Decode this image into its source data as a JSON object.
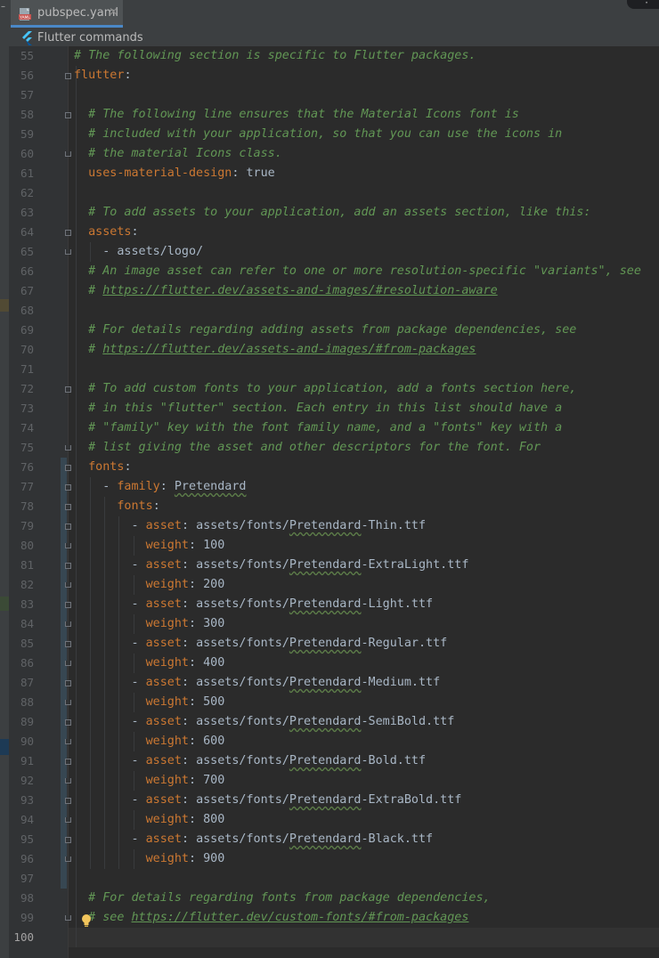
{
  "tab": {
    "title": "pubspec.yaml",
    "file_icon": "yaml-file-icon",
    "close_glyph": "×",
    "icon_badge": "YAML"
  },
  "toolbar": {
    "label": "Flutter commands",
    "icon": "flutter-icon"
  },
  "colors": {
    "comment": "#629755",
    "key": "#cc7832",
    "text": "#a9b7c6",
    "background": "#2b2b2b",
    "gutter": "#313335"
  },
  "current_line": 100,
  "lines": [
    {
      "n": "55",
      "indent": "",
      "comment": "# The following section is specific to Flutter packages."
    },
    {
      "n": "56",
      "indent": "",
      "key": "flutter",
      "sep": ":"
    },
    {
      "n": "57"
    },
    {
      "n": "58",
      "indent": "  ",
      "comment": "# The following line ensures that the Material Icons font is"
    },
    {
      "n": "59",
      "indent": "  ",
      "comment": "# included with your application, so that you can use the icons in"
    },
    {
      "n": "60",
      "indent": "  ",
      "comment": "# the material Icons class."
    },
    {
      "n": "61",
      "indent": "  ",
      "key": "uses-material-design",
      "sep": ": ",
      "value": "true"
    },
    {
      "n": "62"
    },
    {
      "n": "63",
      "indent": "  ",
      "comment": "# To add assets to your application, add an assets section, like this:"
    },
    {
      "n": "64",
      "indent": "  ",
      "key": "assets",
      "sep": ":"
    },
    {
      "n": "65",
      "indent": "    ",
      "plain": "- assets/logo/"
    },
    {
      "n": "66",
      "indent": "  ",
      "comment": "# An image asset can refer to one or more resolution-specific \"variants\", see"
    },
    {
      "n": "67",
      "indent": "  ",
      "comment": "# ",
      "url": "https://flutter.dev/assets-and-images/#resolution-aware"
    },
    {
      "n": "68"
    },
    {
      "n": "69",
      "indent": "  ",
      "comment": "# For details regarding adding assets from package dependencies, see"
    },
    {
      "n": "70",
      "indent": "  ",
      "comment": "# ",
      "url": "https://flutter.dev/assets-and-images/#from-packages"
    },
    {
      "n": "71"
    },
    {
      "n": "72",
      "indent": "  ",
      "comment": "# To add custom fonts to your application, add a fonts section here,"
    },
    {
      "n": "73",
      "indent": "  ",
      "comment": "# in this \"flutter\" section. Each entry in this list should have a"
    },
    {
      "n": "74",
      "indent": "  ",
      "comment": "# \"family\" key with the font family name, and a \"fonts\" key with a"
    },
    {
      "n": "75",
      "indent": "  ",
      "comment": "# list giving the asset and other descriptors for the font. For"
    },
    {
      "n": "76",
      "indent": "  ",
      "key": "fonts",
      "sep": ":"
    },
    {
      "n": "77",
      "indent": "    ",
      "dash": "- ",
      "key": "family",
      "sep": ": ",
      "value": "Pretendard",
      "typo": true
    },
    {
      "n": "78",
      "indent": "      ",
      "key": "fonts",
      "sep": ":"
    },
    {
      "n": "79",
      "indent": "        ",
      "dash": "- ",
      "key": "asset",
      "sep": ": ",
      "path": "assets/fonts/",
      "typo_word": "Pretendard",
      "suffix": "-Thin.ttf"
    },
    {
      "n": "80",
      "indent": "          ",
      "key": "weight",
      "sep": ": ",
      "value": "100"
    },
    {
      "n": "81",
      "indent": "        ",
      "dash": "- ",
      "key": "asset",
      "sep": ": ",
      "path": "assets/fonts/",
      "typo_word": "Pretendard",
      "suffix": "-ExtraLight.ttf"
    },
    {
      "n": "82",
      "indent": "          ",
      "key": "weight",
      "sep": ": ",
      "value": "200"
    },
    {
      "n": "83",
      "indent": "        ",
      "dash": "- ",
      "key": "asset",
      "sep": ": ",
      "path": "assets/fonts/",
      "typo_word": "Pretendard",
      "suffix": "-Light.ttf"
    },
    {
      "n": "84",
      "indent": "          ",
      "key": "weight",
      "sep": ": ",
      "value": "300"
    },
    {
      "n": "85",
      "indent": "        ",
      "dash": "- ",
      "key": "asset",
      "sep": ": ",
      "path": "assets/fonts/",
      "typo_word": "Pretendard",
      "suffix": "-Regular.ttf"
    },
    {
      "n": "86",
      "indent": "          ",
      "key": "weight",
      "sep": ": ",
      "value": "400"
    },
    {
      "n": "87",
      "indent": "        ",
      "dash": "- ",
      "key": "asset",
      "sep": ": ",
      "path": "assets/fonts/",
      "typo_word": "Pretendard",
      "suffix": "-Medium.ttf"
    },
    {
      "n": "88",
      "indent": "          ",
      "key": "weight",
      "sep": ": ",
      "value": "500"
    },
    {
      "n": "89",
      "indent": "        ",
      "dash": "- ",
      "key": "asset",
      "sep": ": ",
      "path": "assets/fonts/",
      "typo_word": "Pretendard",
      "suffix": "-SemiBold.ttf"
    },
    {
      "n": "90",
      "indent": "          ",
      "key": "weight",
      "sep": ": ",
      "value": "600"
    },
    {
      "n": "91",
      "indent": "        ",
      "dash": "- ",
      "key": "asset",
      "sep": ": ",
      "path": "assets/fonts/",
      "typo_word": "Pretendard",
      "suffix": "-Bold.ttf"
    },
    {
      "n": "92",
      "indent": "          ",
      "key": "weight",
      "sep": ": ",
      "value": "700"
    },
    {
      "n": "93",
      "indent": "        ",
      "dash": "- ",
      "key": "asset",
      "sep": ": ",
      "path": "assets/fonts/",
      "typo_word": "Pretendard",
      "suffix": "-ExtraBold.ttf"
    },
    {
      "n": "94",
      "indent": "          ",
      "key": "weight",
      "sep": ": ",
      "value": "800"
    },
    {
      "n": "95",
      "indent": "        ",
      "dash": "- ",
      "key": "asset",
      "sep": ": ",
      "path": "assets/fonts/",
      "typo_word": "Pretendard",
      "suffix": "-Black.ttf"
    },
    {
      "n": "96",
      "indent": "          ",
      "key": "weight",
      "sep": ": ",
      "value": "900"
    },
    {
      "n": "97"
    },
    {
      "n": "98",
      "indent": "  ",
      "comment": "# For details regarding fonts from package dependencies,"
    },
    {
      "n": "99",
      "indent": "  ",
      "comment": "# see ",
      "url": "https://flutter.dev/custom-fonts/#from-packages"
    },
    {
      "n": "100",
      "current": true
    }
  ],
  "folds": {
    "open": [
      "56",
      "58",
      "64",
      "72",
      "76",
      "77",
      "78",
      "79",
      "81",
      "83",
      "85",
      "87",
      "89",
      "91",
      "93",
      "95"
    ],
    "close": [
      "60",
      "65",
      "75",
      "80",
      "82",
      "84",
      "86",
      "88",
      "90",
      "92",
      "94",
      "96",
      "99"
    ]
  }
}
